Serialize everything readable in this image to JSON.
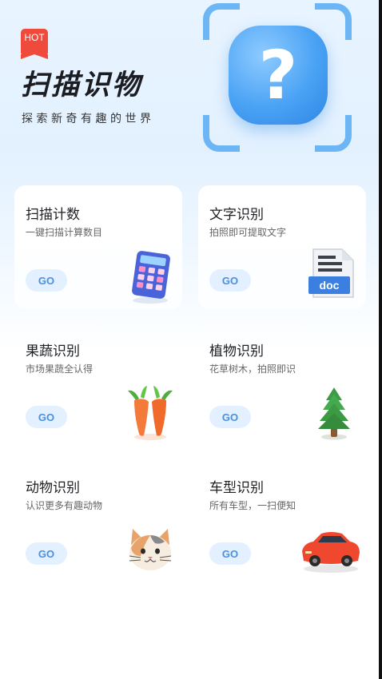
{
  "header": {
    "badge": "HOT",
    "title": "扫描识物",
    "subtitle": "探索新奇有趣的世界",
    "hero_symbol": "?"
  },
  "colors": {
    "accent": "#4ba3f5",
    "go_bg": "#e3f0ff",
    "go_text": "#4a8fe0",
    "badge": "#ef4a3b"
  },
  "cards": [
    {
      "title": "扫描计数",
      "desc": "一键扫描计算数目",
      "action": "GO",
      "icon": "calculator-icon"
    },
    {
      "title": "文字识别",
      "desc": "拍照即可提取文字",
      "action": "GO",
      "icon": "document-icon",
      "icon_label": "doc"
    },
    {
      "title": "果蔬识别",
      "desc": "市场果蔬全认得",
      "action": "GO",
      "icon": "carrot-icon"
    },
    {
      "title": "植物识别",
      "desc": "花草树木，拍照即识",
      "action": "GO",
      "icon": "tree-icon"
    },
    {
      "title": "动物识别",
      "desc": "认识更多有趣动物",
      "action": "GO",
      "icon": "cat-icon"
    },
    {
      "title": "车型识别",
      "desc": "所有车型，一扫便知",
      "action": "GO",
      "icon": "car-icon"
    }
  ]
}
